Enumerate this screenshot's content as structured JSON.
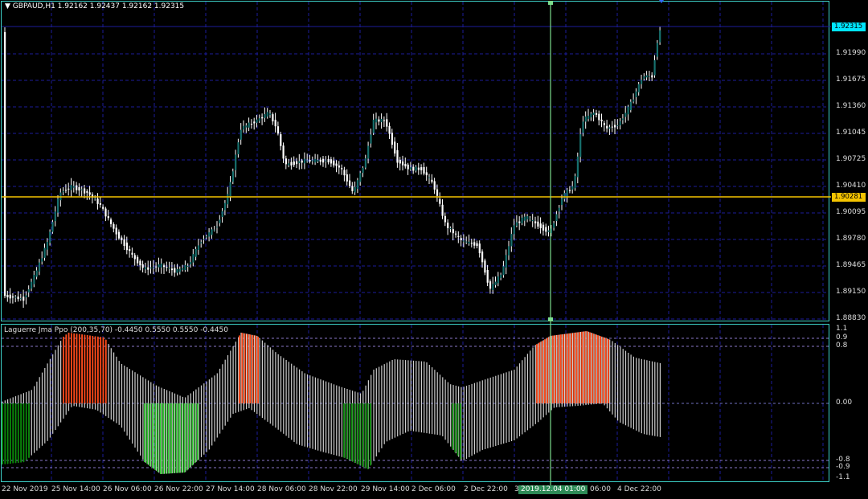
{
  "main_chart": {
    "title": "GBPAUD,H1  1.92162 1.92437 1.92162 1.92315",
    "current_price": "1.92315",
    "line_level": "1.90281",
    "price_ticks": [
      "1.91990",
      "1.91675",
      "1.91360",
      "1.91045",
      "1.90725",
      "1.90410",
      "1.90095",
      "1.89780",
      "1.89465",
      "1.89150",
      "1.88830"
    ],
    "colors": {
      "up_body": "#17706e",
      "down_body": "#ffffff",
      "wick": "#ffffff",
      "grid": "#1c1c9a",
      "horizontal_line": "#f5c400",
      "crosshair": "#7cdc8c",
      "border": "#3dd1c8",
      "price_tag": "#00e5ff"
    }
  },
  "indicator": {
    "title": "Laguerre Jma Ppo (200,35,70) -0.4450 0.5550 0.5550 -0.4450",
    "ticks": [
      "1.1",
      "0.9",
      "0.8",
      "0.00",
      "-0.8",
      "-0.9",
      "-1.1"
    ],
    "colors": {
      "gray": "#cfcfcf",
      "orange": "#ff4a1a",
      "green": "#32c832",
      "dark_green": "#0a8a0a"
    }
  },
  "time_axis": {
    "ticks": [
      "22 Nov 2019",
      "25 Nov 14:00",
      "26 Nov 06:00",
      "26 Nov 22:00",
      "27 Nov 14:00",
      "28 Nov 06:00",
      "28 Nov 22:00",
      "29 Nov 14:00",
      "2 Dec 06:00",
      "2 Dec 22:00",
      "3",
      "06:00",
      "4 Dec 22:00"
    ],
    "crosshair_label": "2019.12.04 01:00"
  }
}
